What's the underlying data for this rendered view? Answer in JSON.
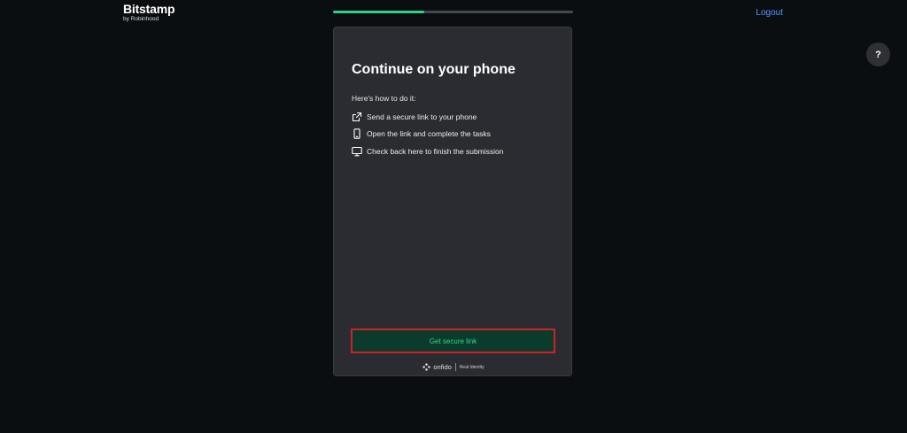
{
  "header": {
    "brand_name": "Bitstamp",
    "brand_sub": "by Robinhood",
    "progress_percent": 38,
    "logout_label": "Logout",
    "help_label": "?"
  },
  "card": {
    "title": "Continue on your phone",
    "intro": "Here's how to do it:",
    "steps": [
      {
        "icon": "external-link-icon",
        "label": "Send a secure link to your phone"
      },
      {
        "icon": "phone-icon",
        "label": "Open the link and complete the tasks"
      },
      {
        "icon": "monitor-icon",
        "label": "Check back here to finish the submission"
      }
    ],
    "cta_label": "Get secure link",
    "footer": {
      "provider": "onfido",
      "tagline": "Real Identity"
    }
  },
  "colors": {
    "background": "#0b0e11",
    "card": "#2b2c31",
    "accent": "#2fd18c",
    "button_bg": "#0a3b2c",
    "button_text": "#35d58d",
    "highlight_border": "#d01f27",
    "link": "#4f9bff"
  }
}
